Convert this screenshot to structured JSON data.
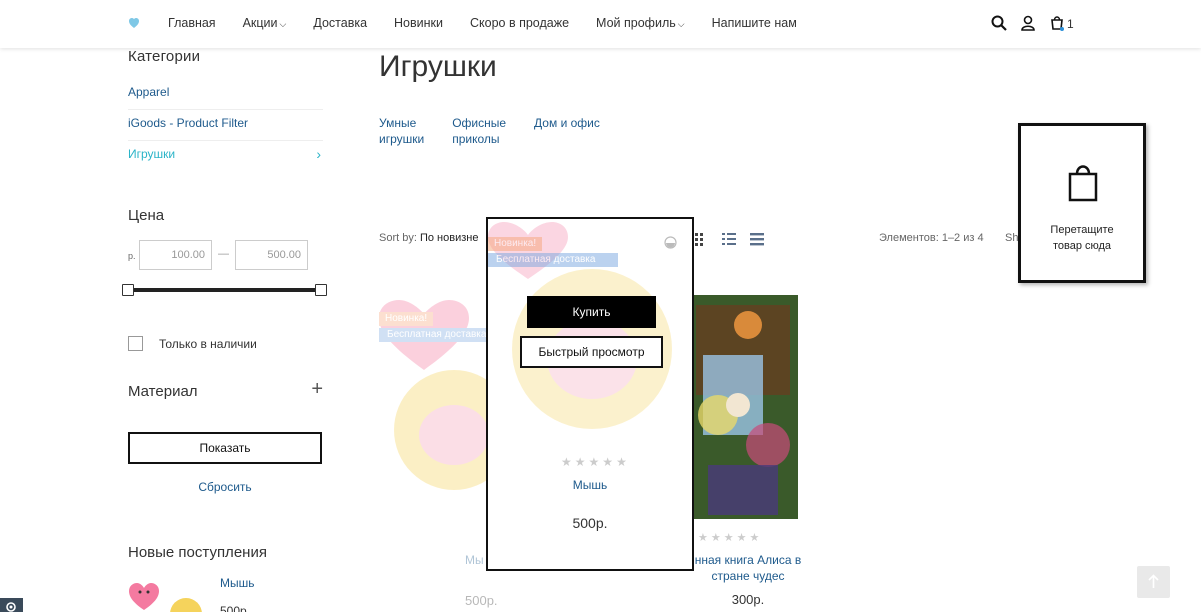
{
  "header": {
    "nav": [
      {
        "label": "Главная",
        "dropdown": false
      },
      {
        "label": "Акции",
        "dropdown": true
      },
      {
        "label": "Доставка",
        "dropdown": false
      },
      {
        "label": "Новинки",
        "dropdown": false
      },
      {
        "label": "Скоро в продаже",
        "dropdown": false
      },
      {
        "label": "Мой профиль",
        "dropdown": true
      },
      {
        "label": "Напишите нам",
        "dropdown": false
      }
    ],
    "cart_count": "1",
    "icons": [
      "search-icon",
      "user-icon",
      "cart-icon"
    ]
  },
  "sidebar": {
    "categories_title": "Категории",
    "categories": [
      {
        "label": "Apparel"
      },
      {
        "label": "iGoods - Product Filter"
      },
      {
        "label": "Игрушки",
        "active": true
      }
    ],
    "price_title": "Цена",
    "currency": "р.",
    "price_min": "100.00",
    "price_max": "500.00",
    "price_separator": "—",
    "in_stock_label": "Только в наличии",
    "material_label": "Материал",
    "show_button": "Показать",
    "reset_link": "Сбросить",
    "new_arrivals_title": "Новые поступления",
    "new_arrival_name": "Мышь",
    "new_arrival_price": "500р."
  },
  "main": {
    "title": "Игрушки",
    "subcategories": [
      {
        "line1": "Умные",
        "line2": "игрушки"
      },
      {
        "line1": "Офисные",
        "line2": "приколы"
      },
      {
        "line1": "Дом и офис",
        "line2": ""
      }
    ],
    "sort_label": "Sort by:",
    "sort_value": "По новизне",
    "elements_text": "Элементов: 1–2 из 4",
    "show_text": "Sh"
  },
  "drop_zone": {
    "text_line1": "Перетащите",
    "text_line2": "товар сюда"
  },
  "hover_card": {
    "badge_new": "Новинка!",
    "badge_free": "Бесплатная доставка",
    "buy_button": "Купить",
    "quick_view_button": "Быстрый просмотр",
    "name": "Мышь",
    "price": "500р."
  },
  "faded_card": {
    "badge_new": "Новинка!",
    "badge_free": "Бесплатная доставка",
    "name": "Мы",
    "price": "500р."
  },
  "product2": {
    "name_line1": "нная книга Алиса в",
    "name_line2": "стране чудес",
    "price": "300р."
  },
  "colors": {
    "link": "#1e5a8c",
    "active": "#2bb4c8",
    "badge_new": "#f7a57a",
    "badge_free": "#7aa7e0"
  }
}
